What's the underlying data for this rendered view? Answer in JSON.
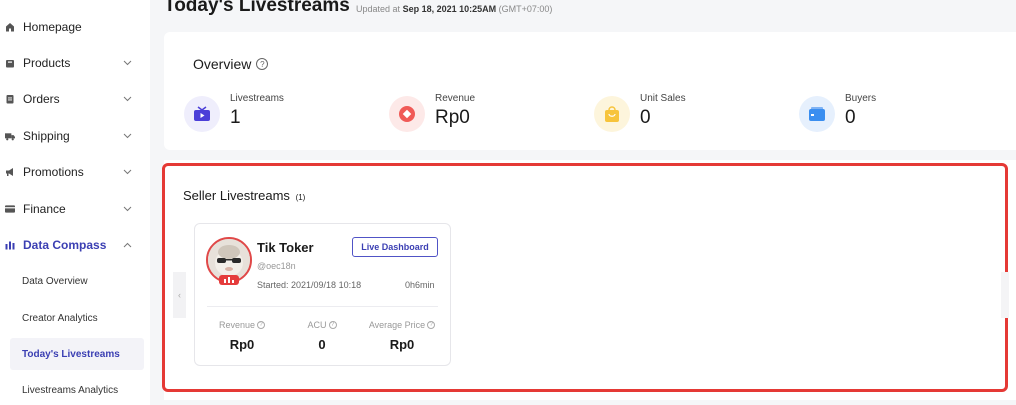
{
  "sidebar": {
    "items": [
      {
        "label": "Homepage",
        "icon": "home-icon"
      },
      {
        "label": "Products",
        "icon": "bag-icon"
      },
      {
        "label": "Orders",
        "icon": "clipboard-icon"
      },
      {
        "label": "Shipping",
        "icon": "truck-icon"
      },
      {
        "label": "Promotions",
        "icon": "megaphone-icon"
      },
      {
        "label": "Finance",
        "icon": "card-icon"
      },
      {
        "label": "Data Compass",
        "icon": "bar-chart-icon"
      }
    ],
    "sub_items": [
      {
        "label": "Data Overview"
      },
      {
        "label": "Creator Analytics"
      },
      {
        "label": "Today's Livestreams"
      },
      {
        "label": "Livestreams Analytics"
      }
    ]
  },
  "header": {
    "title": "Today's Livestreams",
    "updated_prefix": "Updated at",
    "updated_time": "Sep 18, 2021 10:25AM",
    "timezone": "(GMT+07:00)"
  },
  "overview": {
    "title": "Overview",
    "metrics": [
      {
        "label": "Livestreams",
        "value": "1",
        "icon": "tv-icon",
        "color": "#4b3fd8"
      },
      {
        "label": "Revenue",
        "value": "Rp0",
        "icon": "coin-icon",
        "color": "#f05a57"
      },
      {
        "label": "Unit Sales",
        "value": "0",
        "icon": "shopping-bag-icon",
        "color": "#f7c43b"
      },
      {
        "label": "Buyers",
        "value": "0",
        "icon": "wallet-icon",
        "color": "#3a8ef0"
      }
    ]
  },
  "seller": {
    "title": "Seller Livestreams",
    "count": "(1)",
    "card": {
      "name": "Tik Toker",
      "handle": "@oec18n",
      "started": "Started: 2021/09/18 10:18",
      "duration": "0h6min",
      "button_label": "Live Dashboard",
      "stats": [
        {
          "label": "Revenue",
          "value": "Rp0"
        },
        {
          "label": "ACU",
          "value": "0"
        },
        {
          "label": "Average Price",
          "value": "Rp0"
        }
      ]
    }
  },
  "colors": {
    "accent": "#3b3fb3",
    "highlight_border": "#e53935"
  }
}
